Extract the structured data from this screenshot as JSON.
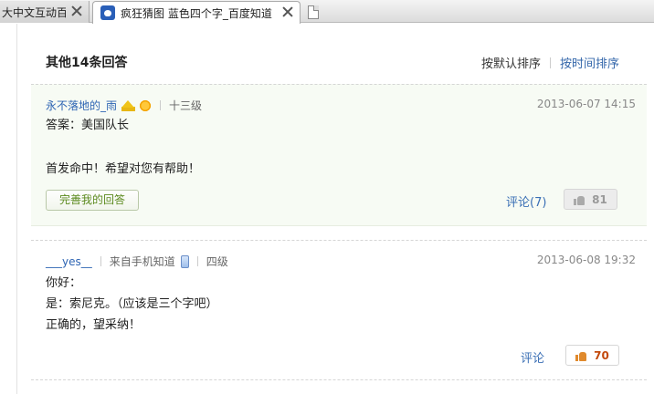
{
  "tabs": [
    {
      "label": "大中文互动百"
    },
    {
      "label": "疯狂猜图 蓝色四个字_百度知道"
    }
  ],
  "section": {
    "title": "其他14条回答",
    "sort_default": "按默认排序",
    "sort_time": "按时间排序"
  },
  "answers": [
    {
      "username": "永不落地的_雨",
      "level": "十三级",
      "date": "2013-06-07 14:15",
      "lines": [
        "答案：美国队长",
        "",
        "首发命中！希望对您有帮助！"
      ],
      "improve_label": "完善我的回答",
      "comment_label": "评论(7)",
      "votes": "81"
    },
    {
      "username": "___yes__",
      "source": "来自手机知道",
      "level": "四级",
      "date": "2013-06-08 19:32",
      "lines": [
        "你好：",
        "是：索尼克。（应该是三个字吧）",
        "正确的，望采纳！"
      ],
      "comment_label": "评论",
      "votes": "70"
    }
  ],
  "colors": {
    "link": "#2d64b3",
    "highlight_bg": "#f7fbf4",
    "vote_orange": "#c34a0d"
  },
  "icons": [
    "paw-icon",
    "close-icon",
    "page-icon",
    "crown-icon",
    "sun-icon",
    "phone-icon",
    "thumbs-up-icon"
  ]
}
